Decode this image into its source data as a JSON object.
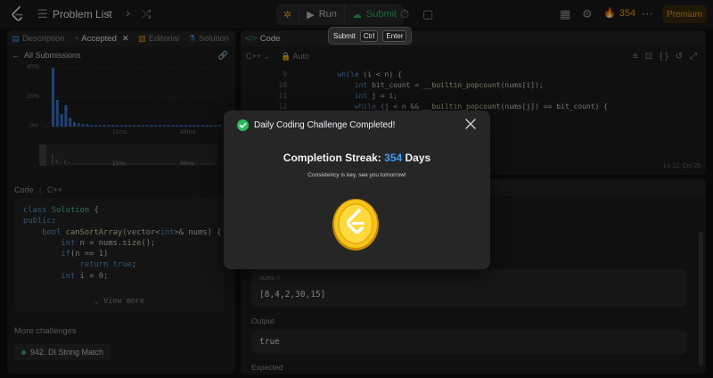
{
  "topbar": {
    "problem_list_label": "Problem List",
    "run_label": "Run",
    "submit_label": "Submit",
    "streak_count": "354",
    "premium_label": "Premium"
  },
  "tooltip": {
    "label": "Submit",
    "key1": "Ctrl",
    "key2": "Enter"
  },
  "left_panel": {
    "tabs": [
      "Description",
      "Accepted",
      "Editorial",
      "Solution"
    ],
    "all_submissions": "All Submissions",
    "chart": {
      "y_ticks": [
        "40%",
        "20%",
        "0%"
      ],
      "x_ticks": [
        "11ms",
        "46ms"
      ],
      "range_labels": [
        "11ms",
        "45ms"
      ]
    },
    "code_label": "Code",
    "code_lang": "C++",
    "view_more": "View more",
    "more_challenges": "More challenges",
    "challenge": "942. DI String Match"
  },
  "editor": {
    "tab": "Code",
    "lang": "C++",
    "mode": "Auto",
    "line_numbers": [
      "9",
      "10",
      "11",
      "12"
    ],
    "status": "Ln 12, Col 29"
  },
  "testcase": {
    "input_label": "nums =",
    "input_value": "[8,4,2,30,15]",
    "output_label": "Output",
    "output_value": "true",
    "expected_label": "Expected"
  },
  "modal": {
    "title": "Daily Coding Challenge Completed!",
    "streak_prefix": "Completion Streak:",
    "streak_value": "354",
    "streak_suffix": "Days",
    "subtitle": "Consistency is key, see you tomorrow!"
  },
  "colors": {
    "accent_orange": "#ffa116",
    "accent_green": "#2cbb5d",
    "accent_blue": "#3a9dff",
    "bg": "#0f0f0f",
    "panel": "#1e1e1e"
  }
}
